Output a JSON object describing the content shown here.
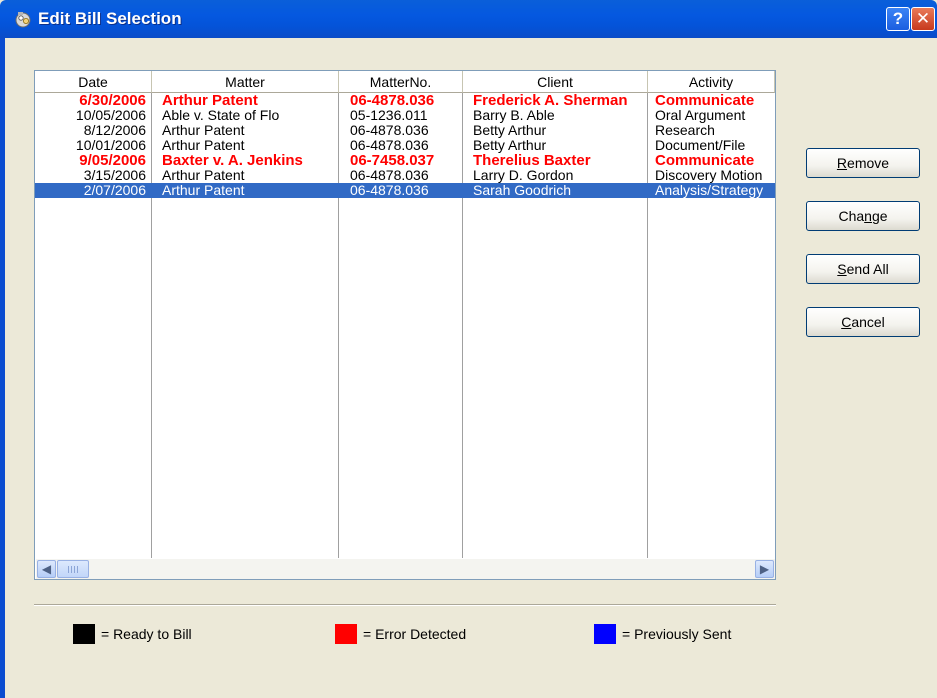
{
  "window": {
    "title": "Edit Bill Selection",
    "help_glyph": "?",
    "close_glyph": "✕"
  },
  "listview": {
    "columns": [
      "Date",
      "Matter",
      "MatterNo.",
      "Client",
      "Activity"
    ],
    "rows": [
      {
        "date": "6/30/2006",
        "matter": "Arthur Patent",
        "matterno": "06-4878.036",
        "client": "Frederick A. Sherman",
        "activity": "Communicate",
        "status": "error"
      },
      {
        "date": "10/05/2006",
        "matter": "Able v. State of Flo",
        "matterno": "05-1236.011",
        "client": "Barry B. Able",
        "activity": "Oral Argument",
        "status": "ready"
      },
      {
        "date": "8/12/2006",
        "matter": "Arthur Patent",
        "matterno": "06-4878.036",
        "client": "Betty Arthur",
        "activity": "Research",
        "status": "ready"
      },
      {
        "date": "10/01/2006",
        "matter": "Arthur Patent",
        "matterno": "06-4878.036",
        "client": "Betty Arthur",
        "activity": "Document/File",
        "status": "ready"
      },
      {
        "date": "9/05/2006",
        "matter": "Baxter v. A. Jenkins",
        "matterno": "06-7458.037",
        "client": "Therelius Baxter",
        "activity": "Communicate",
        "status": "error"
      },
      {
        "date": "3/15/2006",
        "matter": "Arthur Patent",
        "matterno": "06-4878.036",
        "client": "Larry D. Gordon",
        "activity": "Discovery Motion",
        "status": "ready"
      },
      {
        "date": "2/07/2006",
        "matter": "Arthur Patent",
        "matterno": "06-4878.036",
        "client": "Sarah Goodrich",
        "activity": "Analysis/Strategy",
        "status": "selected"
      }
    ],
    "scroll_left_glyph": "◀",
    "scroll_right_glyph": "▶"
  },
  "buttons": {
    "remove": {
      "mnemonic": "R",
      "rest": "emove"
    },
    "change": {
      "pre": "Cha",
      "mnemonic": "n",
      "rest": "ge"
    },
    "send_all": {
      "mnemonic": "S",
      "rest": "end All"
    },
    "cancel": {
      "mnemonic": "C",
      "rest": "ancel"
    }
  },
  "legend": [
    {
      "label": "= Ready to Bill",
      "color": "#000000"
    },
    {
      "label": "= Error Detected",
      "color": "#ff0000"
    },
    {
      "label": "= Previously Sent",
      "color": "#0000ff"
    }
  ],
  "colors": {
    "title_bar": "#0558e0",
    "selection": "#316ac5",
    "error_text": "#ff0000"
  }
}
